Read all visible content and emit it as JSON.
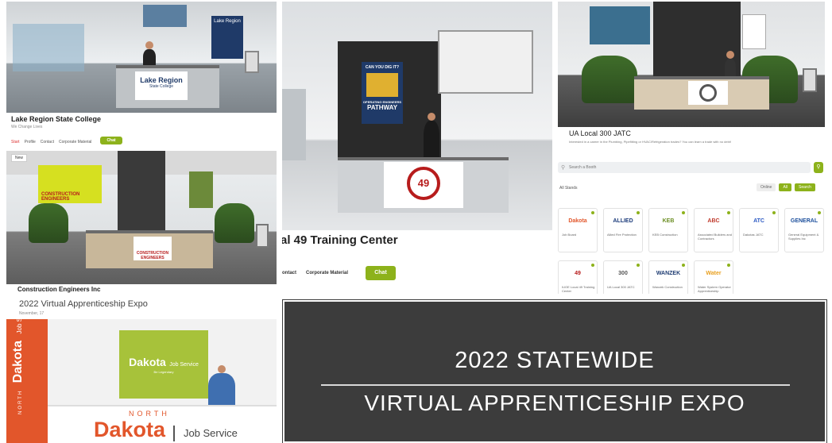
{
  "p1": {
    "booth": "Lake Region State College",
    "sub": "We Change Lives",
    "sign": "Lake Region",
    "sign_sub": "State College",
    "links": [
      "Start",
      "Profile",
      "Contact",
      "Corporate Material"
    ],
    "chat": "Chat"
  },
  "p2": {
    "badge": "New",
    "booth": "Construction Engineers Inc",
    "expo": "2022 Virtual Apprenticeship Expo",
    "date": "November, 17",
    "sign": "CONSTRUCTION ENGINEERS",
    "poster": "CONSTRUCTION ENGINEERS"
  },
  "p3": {
    "poster_top": "CAN YOU DIG IT?",
    "poster_mid": "OPERATING ENGINEERS",
    "poster_bottom": "PATHWAY",
    "emblem": "49",
    "title": "al 49 Training Center",
    "links": [
      "ontact",
      "Corporate Material"
    ],
    "chat": "Chat"
  },
  "p4": {
    "booth": "UA Local 300 JATC",
    "desc": "Interested in a career in the Plumbing, Pipefitting or HVAC/Refrigeration trades? You can learn a trade with no debt!"
  },
  "p5": {
    "search_placeholder": "Search a Booth",
    "filter_label": "All Stands",
    "toggle_labels": [
      "Online",
      "All",
      "Search"
    ],
    "cards": [
      {
        "name": "Job Board",
        "logo": "Dakota",
        "color": "#e2562b"
      },
      {
        "name": "Allied Fire Protection",
        "logo": "ALLIED",
        "color": "#1a3a7a"
      },
      {
        "name": "KEB Construction",
        "logo": "KEB",
        "color": "#6b8e23"
      },
      {
        "name": "Associated Builders and Contractors",
        "logo": "ABC",
        "color": "#c0392b"
      },
      {
        "name": "Dakotas JATC",
        "logo": "ATC",
        "color": "#2b59c3"
      },
      {
        "name": "General Equipment & Supplies Inc",
        "logo": "GENERAL",
        "color": "#1c4f9c"
      },
      {
        "name": "IUOE Local 49 Training Center",
        "logo": "49",
        "color": "#b71c1c"
      },
      {
        "name": "UA Local 300 JATC",
        "logo": "300",
        "color": "#555555"
      },
      {
        "name": "Wanzek Construction",
        "logo": "WANZEK",
        "color": "#1e3c72"
      },
      {
        "name": "Water System Operator Apprenticeship",
        "logo": "Water",
        "color": "#e8a020"
      }
    ]
  },
  "p6": {
    "state_small": "NORTH",
    "brand": "Dakota",
    "brand_sub": "Be Legendary",
    "service": "Job Service"
  },
  "p7": {
    "line1": "2022 STATEWIDE",
    "line2": "VIRTUAL APPRENTICESHIP EXPO"
  }
}
